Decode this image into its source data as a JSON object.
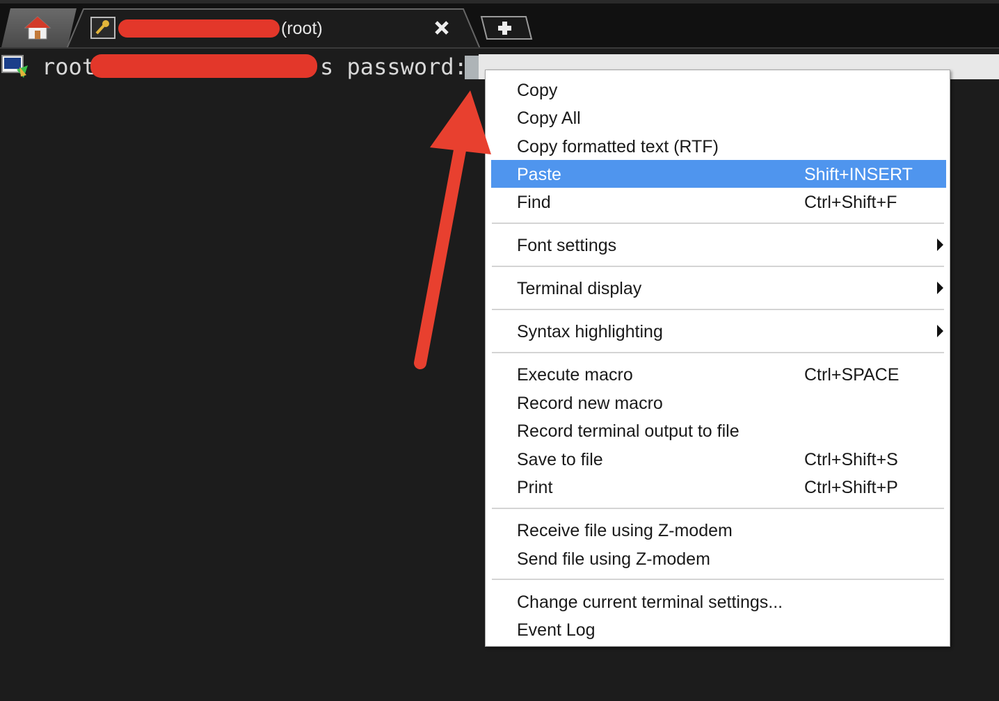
{
  "tab_bar": {
    "session_tab_title": "(root)",
    "close_glyph": "✖",
    "new_tab_glyph": "+",
    "home_icon": "home-icon",
    "session_icon": "key-icon"
  },
  "terminal": {
    "prompt_prefix": "root@",
    "prompt_suffix": "s password:",
    "redaction_color": "#e3372a"
  },
  "context_menu": {
    "selected_color": "#4f95ee",
    "items": [
      {
        "label": "Copy",
        "shortcut": ""
      },
      {
        "label": "Copy All",
        "shortcut": ""
      },
      {
        "label": "Copy formatted text (RTF)",
        "shortcut": ""
      },
      {
        "label": "Paste",
        "shortcut": "Shift+INSERT",
        "selected": true
      },
      {
        "label": "Find",
        "shortcut": "Ctrl+Shift+F"
      },
      {
        "label": "Font settings",
        "submenu": true
      },
      {
        "label": "Terminal display",
        "submenu": true
      },
      {
        "label": "Syntax highlighting",
        "submenu": true
      },
      {
        "label": "Execute macro",
        "shortcut": "Ctrl+SPACE"
      },
      {
        "label": "Record new macro",
        "shortcut": ""
      },
      {
        "label": "Record terminal output to file",
        "shortcut": ""
      },
      {
        "label": "Save to file",
        "shortcut": "Ctrl+Shift+S"
      },
      {
        "label": "Print",
        "shortcut": "Ctrl+Shift+P"
      },
      {
        "label": "Receive file using Z-modem",
        "shortcut": ""
      },
      {
        "label": "Send file using Z-modem",
        "shortcut": ""
      },
      {
        "label": "Change current terminal settings...",
        "shortcut": ""
      },
      {
        "label": "Event Log",
        "shortcut": ""
      }
    ]
  },
  "annotation": {
    "arrow_color": "#e8402f"
  }
}
